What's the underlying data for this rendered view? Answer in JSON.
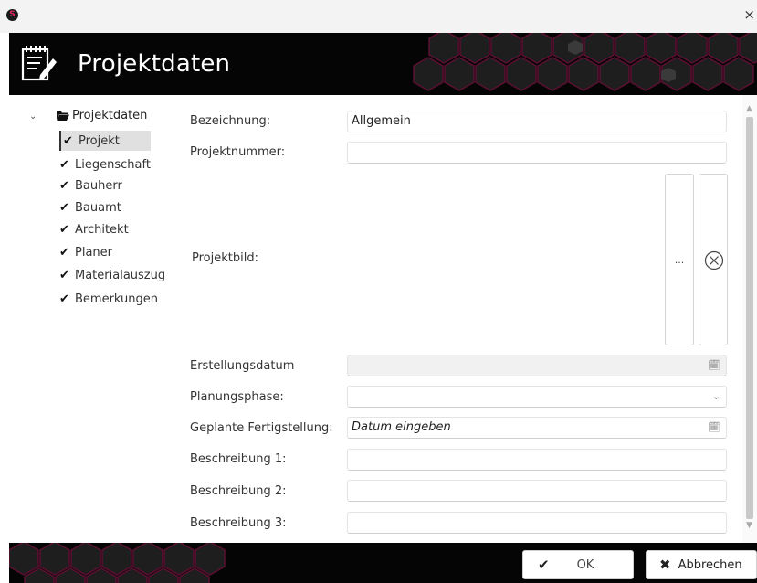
{
  "window": {
    "app_icon_letter": "S",
    "close_glyph": "×"
  },
  "header": {
    "title": "Projektdaten",
    "icon": "notepad-edit-icon"
  },
  "tree": {
    "toggle_glyph": "⌄",
    "root_label": "Projektdaten",
    "items": [
      {
        "label": "Projekt",
        "selected": true
      },
      {
        "label": "Liegenschaft"
      },
      {
        "label": "Bauherr"
      },
      {
        "label": "Bauamt"
      },
      {
        "label": "Architekt"
      },
      {
        "label": "Planer"
      },
      {
        "label": "Materialauszug"
      },
      {
        "label": "Bemerkungen"
      }
    ],
    "check_glyph": "✔"
  },
  "form": {
    "bezeichnung": {
      "label": "Bezeichnung:",
      "value": "Allgemein"
    },
    "projektnummer": {
      "label": "Projektnummer:",
      "value": ""
    },
    "projektbild": {
      "label": "Projektbild:",
      "browse_label": "...",
      "clear_icon": "circle-x-icon"
    },
    "erstellungsdatum": {
      "label": "Erstellungsdatum",
      "value": ""
    },
    "planungsphase": {
      "label": "Planungsphase:",
      "value": ""
    },
    "fertigstellung": {
      "label": "Geplante Fertigstellung:",
      "placeholder": "Datum eingeben"
    },
    "beschreibung1": {
      "label": "Beschreibung 1:",
      "value": ""
    },
    "beschreibung2": {
      "label": "Beschreibung 2:",
      "value": ""
    },
    "beschreibung3": {
      "label": "Beschreibung 3:",
      "value": ""
    },
    "calendar_glyph": "🗓",
    "dropdown_glyph": "⌄"
  },
  "footer": {
    "ok_label": "OK",
    "ok_glyph": "✔",
    "cancel_label": "Abbrechen",
    "cancel_glyph": "✖"
  },
  "colors": {
    "header_bg": "#050505",
    "hex_stroke": "#5a1030",
    "selection_bg": "#e0e0e0"
  }
}
